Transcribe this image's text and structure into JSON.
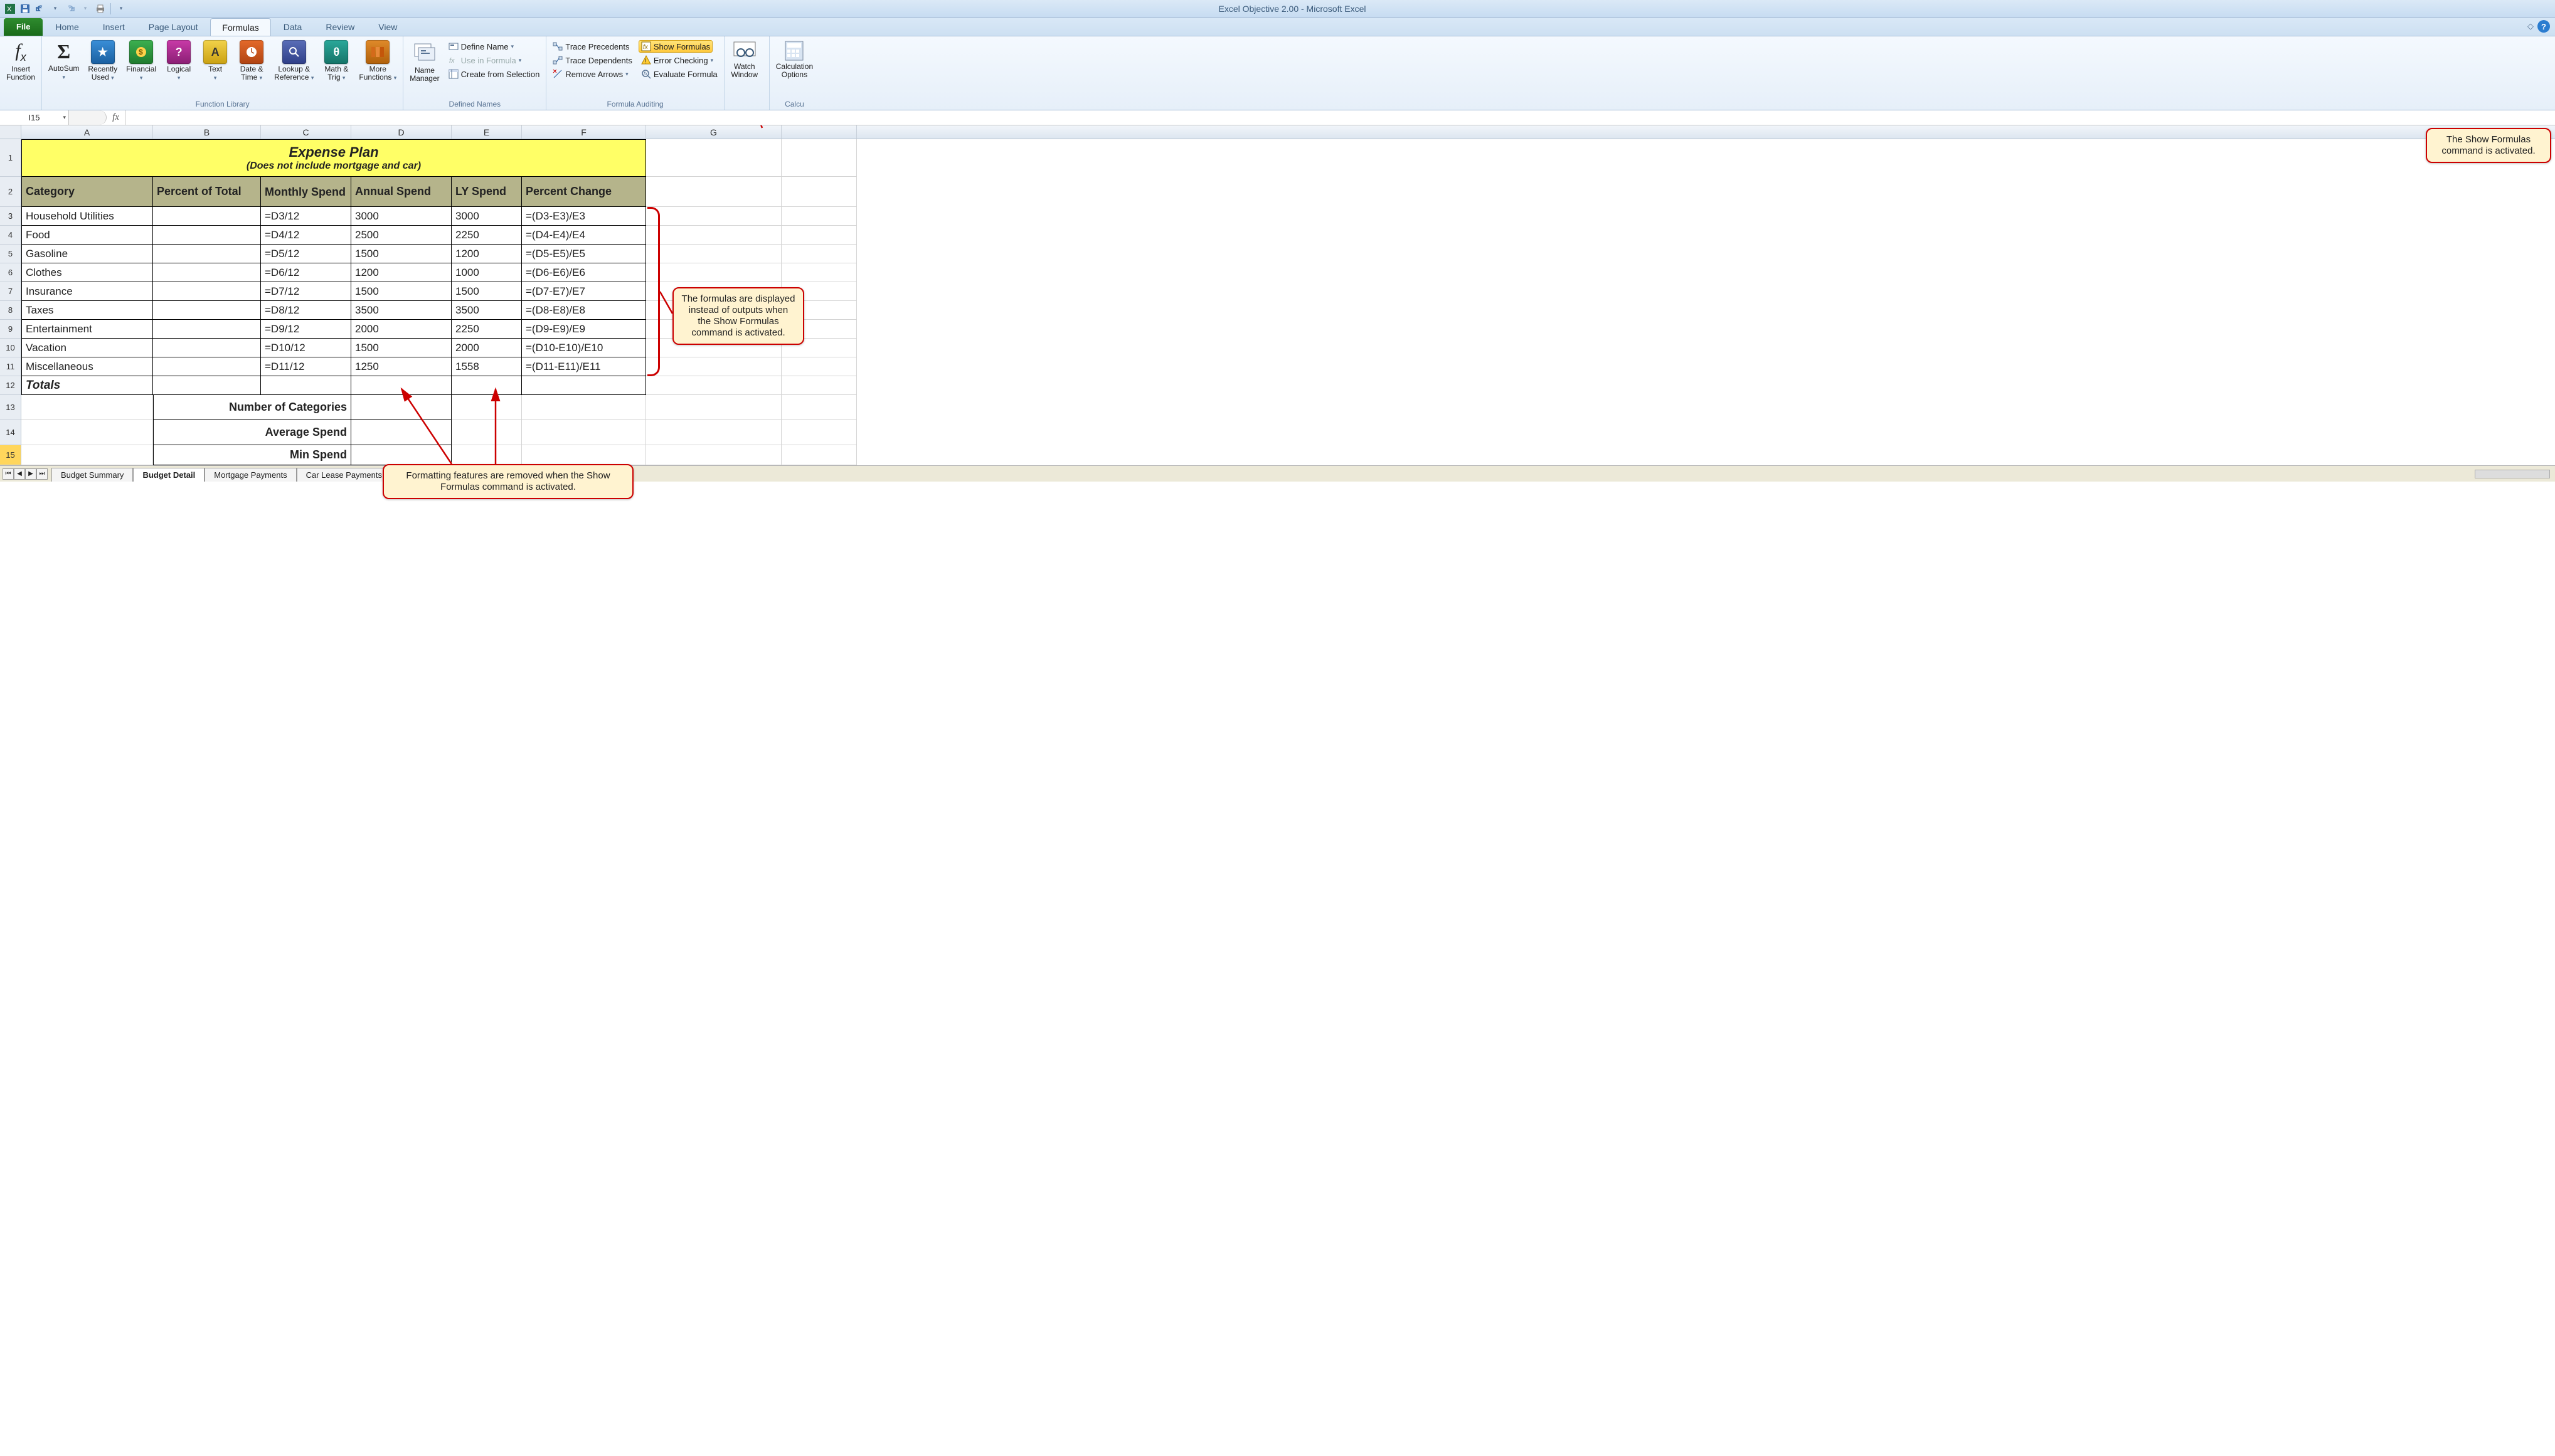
{
  "window": {
    "title": "Excel Objective 2.00 - Microsoft Excel"
  },
  "qat": {
    "save": "Save",
    "undo": "Undo",
    "redo": "Redo",
    "print": "Quick Print"
  },
  "tabs": {
    "file": "File",
    "home": "Home",
    "insert": "Insert",
    "pagelayout": "Page Layout",
    "formulas": "Formulas",
    "data": "Data",
    "review": "Review",
    "view": "View"
  },
  "ribbon": {
    "insert_function": "Insert\nFunction",
    "autosum": "AutoSum",
    "recently_used": "Recently\nUsed",
    "financial": "Financial",
    "logical": "Logical",
    "text": "Text",
    "datetime": "Date &\nTime",
    "lookup": "Lookup &\nReference",
    "mathtrig": "Math &\nTrig",
    "more": "More\nFunctions",
    "group_function_library": "Function Library",
    "name_manager": "Name\nManager",
    "define_name": "Define Name",
    "use_in_formula": "Use in Formula",
    "create_from_selection": "Create from Selection",
    "group_defined_names": "Defined Names",
    "trace_precedents": "Trace Precedents",
    "trace_dependents": "Trace Dependents",
    "remove_arrows": "Remove Arrows",
    "show_formulas": "Show Formulas",
    "error_checking": "Error Checking",
    "evaluate_formula": "Evaluate Formula",
    "group_formula_auditing": "Formula Auditing",
    "watch_window": "Watch\nWindow",
    "calc_options": "Calculation\nOptions",
    "group_calc": "Calcu"
  },
  "formula_bar": {
    "namebox": "I15",
    "fx": "fx",
    "value": ""
  },
  "columns": [
    "A",
    "B",
    "C",
    "D",
    "E",
    "F",
    "G"
  ],
  "title_row": {
    "title": "Expense Plan",
    "subtitle": "(Does not include mortgage and car)"
  },
  "headers": {
    "A": "Category",
    "B": "Percent of Total",
    "C": "Monthly Spend",
    "D": "Annual Spend",
    "E": "LY Spend",
    "F": "Percent Change"
  },
  "rows": [
    {
      "n": 3,
      "A": "Household Utilities",
      "B": "",
      "C": "=D3/12",
      "D": "3000",
      "E": "3000",
      "F": "=(D3-E3)/E3"
    },
    {
      "n": 4,
      "A": "Food",
      "B": "",
      "C": "=D4/12",
      "D": "2500",
      "E": "2250",
      "F": "=(D4-E4)/E4"
    },
    {
      "n": 5,
      "A": "Gasoline",
      "B": "",
      "C": "=D5/12",
      "D": "1500",
      "E": "1200",
      "F": "=(D5-E5)/E5"
    },
    {
      "n": 6,
      "A": "Clothes",
      "B": "",
      "C": "=D6/12",
      "D": "1200",
      "E": "1000",
      "F": "=(D6-E6)/E6"
    },
    {
      "n": 7,
      "A": "Insurance",
      "B": "",
      "C": "=D7/12",
      "D": "1500",
      "E": "1500",
      "F": "=(D7-E7)/E7"
    },
    {
      "n": 8,
      "A": "Taxes",
      "B": "",
      "C": "=D8/12",
      "D": "3500",
      "E": "3500",
      "F": "=(D8-E8)/E8"
    },
    {
      "n": 9,
      "A": "Entertainment",
      "B": "",
      "C": "=D9/12",
      "D": "2000",
      "E": "2250",
      "F": "=(D9-E9)/E9"
    },
    {
      "n": 10,
      "A": "Vacation",
      "B": "",
      "C": "=D10/12",
      "D": "1500",
      "E": "2000",
      "F": "=(D10-E10)/E10"
    },
    {
      "n": 11,
      "A": "Miscellaneous",
      "B": "",
      "C": "=D11/12",
      "D": "1250",
      "E": "1558",
      "F": "=(D11-E11)/E11"
    }
  ],
  "totals_label": "Totals",
  "summary_labels": {
    "num_cat": "Number of Categories",
    "avg": "Average Spend",
    "min": "Min Spend"
  },
  "sheet_tabs": [
    "Budget Summary",
    "Budget Detail",
    "Mortgage Payments",
    "Car Lease Payments"
  ],
  "active_sheet_tab": 1,
  "callouts": {
    "c1": "The Show Formulas command is activated.",
    "c2": "The formulas are displayed instead of outputs when the Show Formulas command is activated.",
    "c3": "Formatting features are removed when the Show Formulas command is activated."
  }
}
